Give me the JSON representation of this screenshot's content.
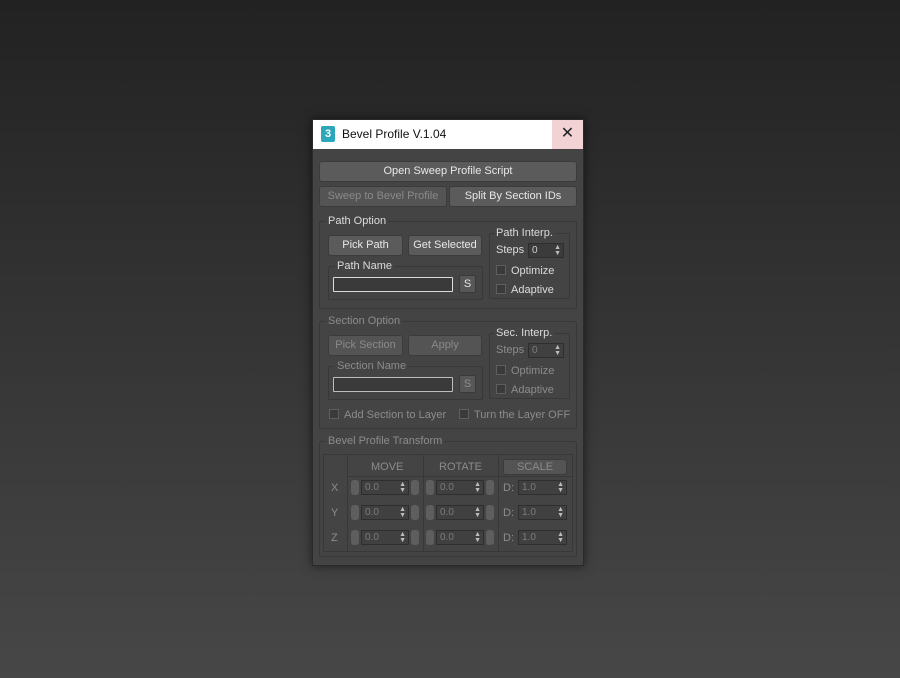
{
  "window": {
    "title": "Bevel Profile V.1.04",
    "app_icon_glyph": "3",
    "close_glyph": "✕"
  },
  "buttons": {
    "open_sweep": "Open Sweep Profile Script",
    "sweep_to_bevel": "Sweep to Bevel Profile",
    "split_by_section": "Split By Section IDs"
  },
  "path_option": {
    "title": "Path Option",
    "pick_path": "Pick Path",
    "get_selected": "Get Selected",
    "path_name_label": "Path Name",
    "path_name_value": "",
    "s_button": "S",
    "interp": {
      "title": "Path Interp.",
      "steps_label": "Steps",
      "steps_value": "0",
      "optimize": "Optimize",
      "adaptive": "Adaptive"
    }
  },
  "section_option": {
    "title": "Section Option",
    "pick_section": "Pick Section",
    "apply": "Apply",
    "section_name_label": "Section Name",
    "section_name_value": "",
    "s_button": "S",
    "interp": {
      "title": "Sec. Interp.",
      "steps_label": "Steps",
      "steps_value": "0",
      "optimize": "Optimize",
      "adaptive": "Adaptive"
    },
    "add_to_layer": "Add Section to Layer",
    "turn_layer_off": "Turn the Layer OFF"
  },
  "transform": {
    "title": "Bevel Profile Transform",
    "headers": {
      "move": "MOVE",
      "rotate": "ROTATE",
      "scale": "SCALE"
    },
    "rows": [
      {
        "axis": "X",
        "move": "0.0",
        "rotate": "0.0",
        "scale_prefix": "D:",
        "scale": "1.0"
      },
      {
        "axis": "Y",
        "move": "0.0",
        "rotate": "0.0",
        "scale_prefix": "D:",
        "scale": "1.0"
      },
      {
        "axis": "Z",
        "move": "0.0",
        "rotate": "0.0",
        "scale_prefix": "D:",
        "scale": "1.0"
      }
    ]
  },
  "colors": {
    "window_bg": "#444444",
    "titlebar_bg": "#ffffff",
    "close_bg": "#f3d2d6",
    "icon_accent": "#2aa7b8"
  }
}
